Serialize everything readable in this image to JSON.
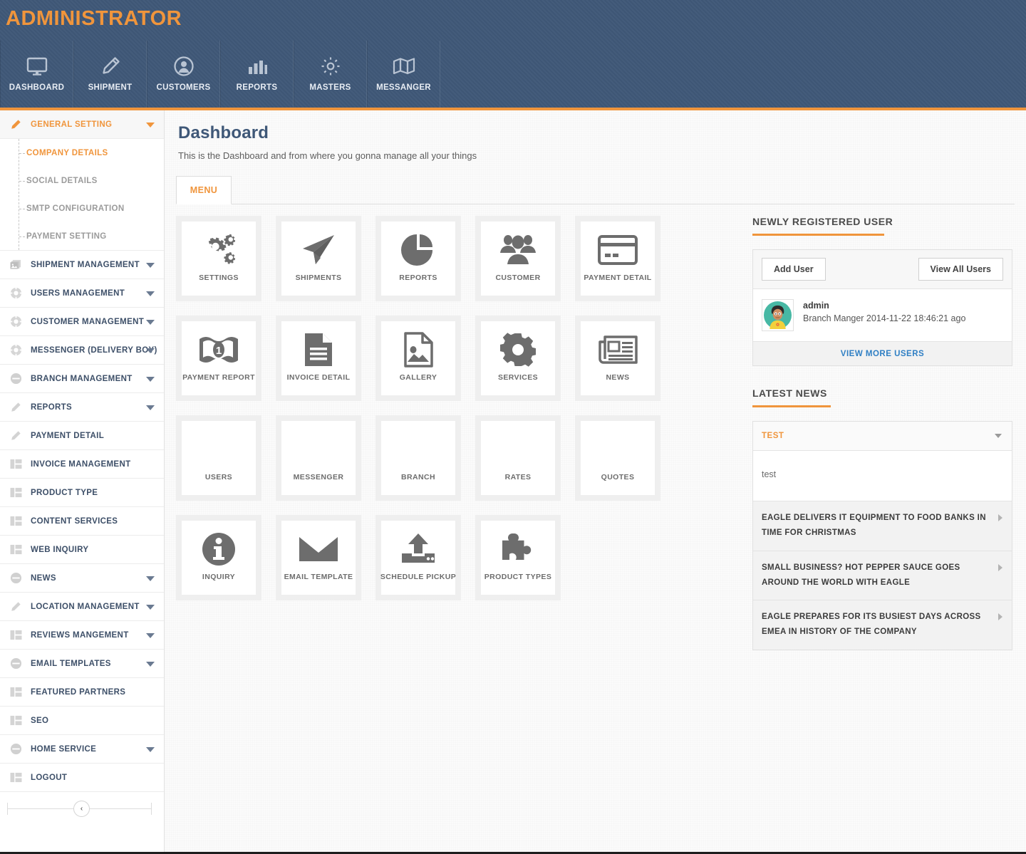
{
  "brand": {
    "title": "ADMINISTRATOR"
  },
  "topnav": [
    {
      "label": "DASHBOARD",
      "icon": "monitor-icon"
    },
    {
      "label": "SHIPMENT",
      "icon": "pencil-icon"
    },
    {
      "label": "CUSTOMERS",
      "icon": "user-circle-icon"
    },
    {
      "label": "REPORTS",
      "icon": "bar-chart-icon"
    },
    {
      "label": "MASTERS",
      "icon": "gear-icon"
    },
    {
      "label": "MESSANGER",
      "icon": "map-icon"
    }
  ],
  "sidebar": {
    "items": [
      {
        "label": "GENERAL SETTING",
        "icon": "pencil-icon",
        "caret": true,
        "active": true
      },
      {
        "label": "SHIPMENT MANAGEMENT",
        "icon": "images-icon",
        "caret": true,
        "active": false
      },
      {
        "label": "USERS MANAGEMENT",
        "icon": "lifebuoy-icon",
        "caret": true,
        "active": false
      },
      {
        "label": "CUSTOMER MANAGEMENT",
        "icon": "lifebuoy-icon",
        "caret": true,
        "active": false
      },
      {
        "label": "MESSENGER (DELIVERY BOY)",
        "icon": "lifebuoy-icon",
        "caret": true,
        "active": false
      },
      {
        "label": "BRANCH MANAGEMENT",
        "icon": "minus-circle-icon",
        "caret": true,
        "active": false
      },
      {
        "label": "REPORTS",
        "icon": "pencil-icon",
        "caret": true,
        "active": false
      },
      {
        "label": "PAYMENT DETAIL",
        "icon": "pencil-icon",
        "caret": false,
        "active": false
      },
      {
        "label": "INVOICE MANAGEMENT",
        "icon": "layout-icon",
        "caret": false,
        "active": false
      },
      {
        "label": "PRODUCT TYPE",
        "icon": "layout-icon",
        "caret": false,
        "active": false
      },
      {
        "label": "CONTENT SERVICES",
        "icon": "layout-icon",
        "caret": false,
        "active": false
      },
      {
        "label": "WEB INQUIRY",
        "icon": "layout-icon",
        "caret": false,
        "active": false
      },
      {
        "label": "NEWS",
        "icon": "minus-circle-icon",
        "caret": true,
        "active": false
      },
      {
        "label": "LOCATION MANAGEMENT",
        "icon": "pencil-icon",
        "caret": true,
        "active": false
      },
      {
        "label": "REVIEWS MANGEMENT",
        "icon": "layout-icon",
        "caret": true,
        "active": false
      },
      {
        "label": "EMAIL TEMPLATES",
        "icon": "minus-circle-icon",
        "caret": true,
        "active": false
      },
      {
        "label": "FEATURED PARTNERS",
        "icon": "layout-icon",
        "caret": false,
        "active": false
      },
      {
        "label": "SEO",
        "icon": "layout-icon",
        "caret": false,
        "active": false
      },
      {
        "label": "HOME SERVICE",
        "icon": "minus-circle-icon",
        "caret": true,
        "active": false
      },
      {
        "label": "LOGOUT",
        "icon": "layout-icon",
        "caret": false,
        "active": false
      }
    ],
    "submenu": [
      {
        "label": "COMPANY DETAILS",
        "active": true
      },
      {
        "label": "SOCIAL DETAILS",
        "active": false
      },
      {
        "label": "SMTP CONFIGURATION",
        "active": false
      },
      {
        "label": "PAYMENT SETTING",
        "active": false
      }
    ],
    "collapse_glyph": "‹"
  },
  "main": {
    "title": "Dashboard",
    "subtitle": "This is the Dashboard and from where you gonna manage all your things",
    "tab_label": "MENU",
    "tiles": [
      [
        {
          "label": "SETTINGS",
          "icon": "gears-icon"
        },
        {
          "label": "SHIPMENTS",
          "icon": "paper-plane-icon"
        },
        {
          "label": "REPORTS",
          "icon": "pie-chart-icon"
        },
        {
          "label": "CUSTOMER",
          "icon": "group-users-icon"
        },
        {
          "label": "PAYMENT DETAIL",
          "icon": "credit-card-icon"
        }
      ],
      [
        {
          "label": "PAYMENT REPORT",
          "icon": "banknote-icon"
        },
        {
          "label": "INVOICE DETAIL",
          "icon": "document-icon"
        },
        {
          "label": "GALLERY",
          "icon": "image-file-icon"
        },
        {
          "label": "SERVICES",
          "icon": "gear-icon"
        },
        {
          "label": "NEWS",
          "icon": "newspaper-icon"
        }
      ],
      [
        {
          "label": "USERS",
          "icon": ""
        },
        {
          "label": "MESSENGER",
          "icon": ""
        },
        {
          "label": "BRANCH",
          "icon": ""
        },
        {
          "label": "RATES",
          "icon": ""
        },
        {
          "label": "QUOTES",
          "icon": ""
        }
      ],
      [
        {
          "label": "INQUIRY",
          "icon": "info-circle-icon"
        },
        {
          "label": "EMAIL TEMPLATE",
          "icon": "envelope-icon"
        },
        {
          "label": "SCHEDULE PICKUP",
          "icon": "upload-icon"
        },
        {
          "label": "PRODUCT TYPES",
          "icon": "puzzle-icon"
        }
      ]
    ]
  },
  "right_panel": {
    "users": {
      "heading": "NEWLY REGISTERED USER",
      "add_user_label": "Add User",
      "view_all_label": "View All Users",
      "user_name": "admin",
      "user_meta": "Branch Manger 2014-11-22 18:46:21 ago",
      "view_more_label": "VIEW MORE USERS"
    },
    "news": {
      "heading": "LATEST NEWS",
      "accordion_title": "TEST",
      "accordion_body": "test",
      "items": [
        {
          "title": "EAGLE DELIVERS IT EQUIPMENT TO FOOD BANKS IN TIME FOR CHRISTMAS"
        },
        {
          "title": "SMALL BUSINESS? HOT PEPPER SAUCE GOES AROUND THE WORLD WITH EAGLE"
        },
        {
          "title": "EAGLE PREPARES FOR ITS BUSIEST DAYS ACROSS EMEA IN HISTORY OF THE COMPANY"
        }
      ]
    }
  },
  "colors": {
    "header_blue": "#3f5878",
    "accent_orange": "#f0953c",
    "link_blue": "#2f7fc4",
    "icon_gray": "#6d6d6d"
  }
}
